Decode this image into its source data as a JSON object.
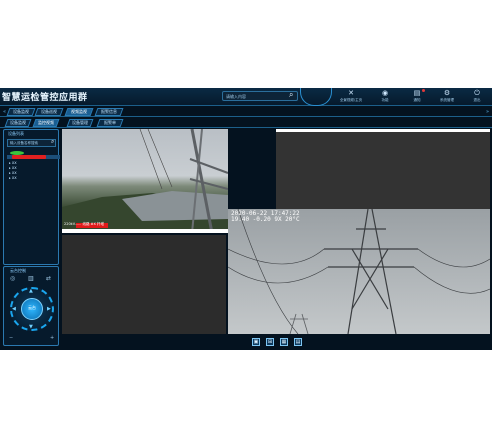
{
  "app": {
    "title": "智慧运检管控应用群"
  },
  "header": {
    "search_value": "请输入内容",
    "buttons": [
      {
        "label": "全景视频/主页",
        "icon": "close-x-icon"
      },
      {
        "label": "功能",
        "icon": "globe-icon"
      },
      {
        "label": "通知",
        "icon": "message-icon"
      },
      {
        "label": "系统管理",
        "icon": "settings-icon"
      },
      {
        "label": "退出",
        "icon": "power-icon"
      }
    ]
  },
  "tabs_row1": [
    "设备监视",
    "设备巡视",
    "视频监视",
    "报警信息"
  ],
  "tabs_row2": [
    "设备监视",
    "监控视频",
    "设备管理",
    "报警单"
  ],
  "tabs_row1_active": 2,
  "device_panel": {
    "title": "设备列表",
    "search_placeholder": "输入设备名称搜索",
    "tree": [
      "▸ XX",
      "▸ XX",
      "▸ XX",
      "▸ XX"
    ]
  },
  "ptz_panel": {
    "title": "云台控制",
    "center_label": "云台",
    "tools": [
      "◎",
      "▥",
      "⇄"
    ]
  },
  "panes": {
    "pane1_osd": "220kV...... 线路 #X 杆塔",
    "pane4_date": "2020-06-22 17:47:22",
    "pane4_coord": "19.40 -0.20 9X 20°C"
  },
  "bottom_bar": {
    "layouts": [
      "▣",
      "⊞",
      "▦",
      "▤"
    ]
  },
  "colors": {
    "accent": "#2b79b0",
    "background": "#04121f",
    "active_tab": "#1a5e92"
  }
}
